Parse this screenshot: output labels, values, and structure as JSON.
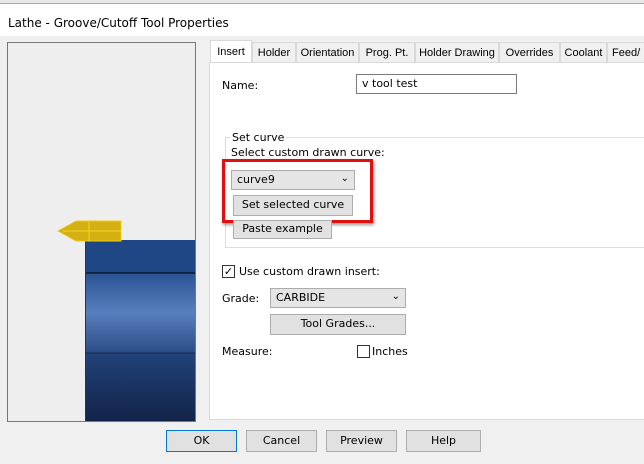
{
  "window": {
    "title": "Lathe - Groove/Cutoff Tool Properties"
  },
  "tabs": [
    "Insert",
    "Holder",
    "Orientation",
    "Prog. Pt.",
    "Holder Drawing",
    "Overrides",
    "Coolant",
    "Feed/"
  ],
  "insert": {
    "name_label": "Name:",
    "name_value": "v tool test",
    "group_title": "Set curve",
    "curve_label": "Select custom drawn curve:",
    "curve_value": "curve9",
    "set_curve_button": "Set selected curve",
    "paste_button": "Paste example",
    "use_custom_label": "Use custom drawn insert:",
    "use_custom_checked": true,
    "grade_label": "Grade:",
    "grade_value": "CARBIDE",
    "tool_grades_button": "Tool Grades...",
    "measure_label": "Measure:",
    "inches_label": "Inches",
    "inches_checked": false
  },
  "buttons": {
    "ok": "OK",
    "cancel": "Cancel",
    "preview": "Preview",
    "help": "Help"
  },
  "colors": {
    "insert": "#d4b012",
    "holder": "#1f4a8a",
    "highlight": "#e01010"
  }
}
